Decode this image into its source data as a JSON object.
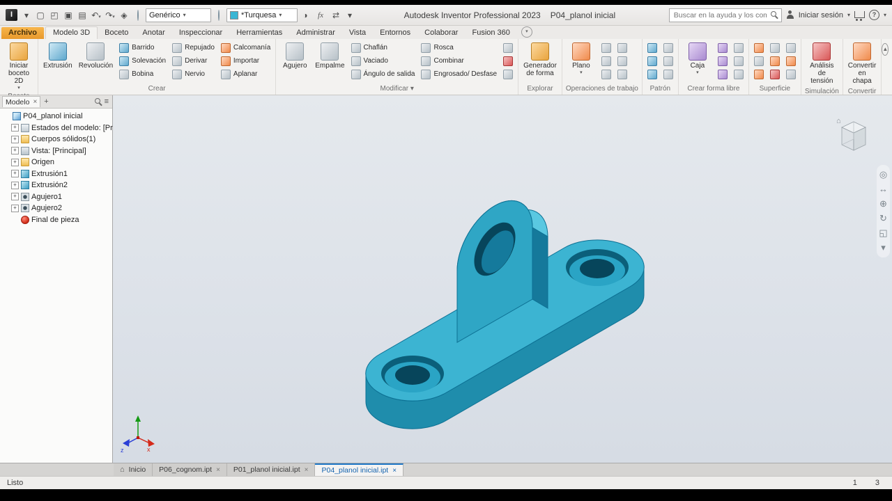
{
  "titlebar": {
    "app_title": "Autodesk Inventor Professional 2023",
    "doc_title": "P04_planol inicial",
    "template_combo": "Genérico",
    "appearance_combo": "*Turquesa",
    "appearance_swatch": "#3ab6d4",
    "search_placeholder": "Buscar en la ayuda y los comanc",
    "sign_in_label": "Iniciar sesión",
    "left_icons": [
      "app-menu-arrow",
      "new-file",
      "open-folder",
      "save",
      "print",
      "undo",
      "redo",
      "iproperties",
      "material-sphere"
    ],
    "post_icons": [
      "adjust-appearance",
      "parameters-fx",
      "exchange-arrows",
      "overflow-arrow"
    ]
  },
  "tabs": [
    {
      "label": "Archivo",
      "accent": true
    },
    {
      "label": "Modelo 3D",
      "active": true
    },
    {
      "label": "Boceto"
    },
    {
      "label": "Anotar"
    },
    {
      "label": "Inspeccionar"
    },
    {
      "label": "Herramientas"
    },
    {
      "label": "Administrar"
    },
    {
      "label": "Vista"
    },
    {
      "label": "Entornos"
    },
    {
      "label": "Colaborar"
    },
    {
      "label": "Fusion 360"
    }
  ],
  "ribbon": {
    "panels": [
      {
        "label": "Boceto",
        "big": [
          {
            "label": "Iniciar boceto 2D",
            "icon": "sketch-2d",
            "arrow": true
          }
        ]
      },
      {
        "label": "Crear",
        "big": [
          {
            "label": "Extrusión",
            "icon": "extrude"
          },
          {
            "label": "Revolución",
            "icon": "revolve"
          }
        ],
        "cols": [
          [
            {
              "label": "Barrido",
              "icon": "sweep"
            },
            {
              "label": "Solevación",
              "icon": "loft"
            },
            {
              "label": "Bobina",
              "icon": "coil"
            }
          ],
          [
            {
              "label": "Repujado",
              "icon": "emboss"
            },
            {
              "label": "Derivar",
              "icon": "derive"
            },
            {
              "label": "Nervio",
              "icon": "rib"
            }
          ],
          [
            {
              "label": "Calcomanía",
              "icon": "decal"
            },
            {
              "label": "Importar",
              "icon": "import"
            },
            {
              "label": "Aplanar",
              "icon": "unwrap"
            }
          ]
        ]
      },
      {
        "label": "Modificar",
        "arrow": true,
        "big": [
          {
            "label": "Agujero",
            "icon": "hole"
          },
          {
            "label": "Empalme",
            "icon": "fillet"
          }
        ],
        "cols": [
          [
            {
              "label": "Chaflán",
              "icon": "chamfer"
            },
            {
              "label": "Vaciado",
              "icon": "shell"
            },
            {
              "label": "Ángulo de salida",
              "icon": "draft"
            }
          ],
          [
            {
              "label": "Rosca",
              "icon": "thread"
            },
            {
              "label": "Combinar",
              "icon": "combine"
            },
            {
              "label": "Engrosado/ Desfase",
              "icon": "thicken"
            }
          ],
          [
            {
              "icon": "split"
            },
            {
              "icon": "delete-face"
            },
            {
              "icon": "move-body"
            }
          ]
        ]
      },
      {
        "label": "Explorar",
        "big": [
          {
            "label": "Generador de forma",
            "icon": "shape-generator"
          }
        ]
      },
      {
        "label": "Operaciones de trabajo",
        "big": [
          {
            "label": "Plano",
            "icon": "work-plane",
            "arrow": true
          }
        ],
        "cols": [
          [
            {
              "icon": "work-axis"
            },
            {
              "icon": "work-point"
            },
            {
              "icon": "ucs"
            }
          ],
          [
            {
              "icon": "axis-from-edge"
            },
            {
              "icon": "grounded-point"
            },
            {
              "icon": "ucs-3points"
            }
          ]
        ]
      },
      {
        "label": "Patrón",
        "cols": [
          [
            {
              "icon": "pattern-rectangular"
            },
            {
              "icon": "pattern-circular"
            },
            {
              "icon": "mirror"
            }
          ],
          [
            {
              "icon": "pattern-sketch"
            },
            {
              "icon": "pattern-feature"
            },
            {
              "icon": "pattern-path"
            }
          ]
        ]
      },
      {
        "label": "Crear forma libre",
        "big": [
          {
            "label": "Caja",
            "icon": "freeform-box",
            "arrow": true
          }
        ],
        "cols": [
          [
            {
              "icon": "freeform-plane"
            },
            {
              "icon": "freeform-cylinder"
            },
            {
              "icon": "freeform-sphere"
            }
          ],
          [
            {
              "icon": "freeform-torus"
            },
            {
              "icon": "freeform-quadball"
            },
            {
              "icon": "freeform-edit"
            }
          ]
        ]
      },
      {
        "label": "Superficie",
        "cols": [
          [
            {
              "icon": "surface-stitch"
            },
            {
              "icon": "surface-patch"
            },
            {
              "icon": "surface-trim"
            }
          ],
          [
            {
              "icon": "surface-extend"
            },
            {
              "icon": "surface-sculpt"
            },
            {
              "icon": "surface-repair"
            }
          ],
          [
            {
              "icon": "surface-offset"
            },
            {
              "icon": "surface-delete"
            },
            {
              "icon": "surface-fit"
            }
          ]
        ]
      },
      {
        "label": "Simulación",
        "big": [
          {
            "label": "Análisis de tensión",
            "icon": "stress-analysis"
          }
        ]
      },
      {
        "label": "Convertir",
        "big": [
          {
            "label": "Convertir en chapa",
            "icon": "sheet-metal"
          }
        ]
      }
    ]
  },
  "browser": {
    "tab": "Modelo",
    "items": [
      {
        "label": "P04_planol inicial",
        "icon": "part-root",
        "level": 0,
        "expander": "none"
      },
      {
        "label": "Estados del modelo: [Principal]",
        "icon": "model-states",
        "level": 1,
        "expander": "plus"
      },
      {
        "label": "Cuerpos sólidos(1)",
        "icon": "solid-bodies",
        "level": 1,
        "expander": "plus"
      },
      {
        "label": "Vista: [Principal]",
        "icon": "view-rep",
        "level": 1,
        "expander": "plus"
      },
      {
        "label": "Origen",
        "icon": "origin-folder",
        "level": 1,
        "expander": "plus"
      },
      {
        "label": "Extrusión1",
        "icon": "extrusion-feat",
        "level": 1,
        "expander": "plus"
      },
      {
        "label": "Extrusión2",
        "icon": "extrusion-feat",
        "level": 1,
        "expander": "plus"
      },
      {
        "label": "Agujero1",
        "icon": "hole-feat",
        "level": 1,
        "expander": "plus"
      },
      {
        "label": "Agujero2",
        "icon": "hole-feat",
        "level": 1,
        "expander": "plus"
      },
      {
        "label": "Final de pieza",
        "icon": "end-of-part",
        "level": 1,
        "expander": "none"
      }
    ]
  },
  "viewport": {
    "palette": {
      "top": "#3cb4d2",
      "side": "#1f8dac",
      "lug_front": "#2fa6c5",
      "lug_band": "#5ac8e1",
      "lug_side": "#15799b",
      "hole_wall": "#0b5f7a",
      "hole_floor": "#2aa4c5",
      "hole_inner": "#07455b",
      "lug_hole_lit": "#157a9c",
      "edge": "#0c7093"
    },
    "triad_labels": {
      "x": "x",
      "z": "z"
    },
    "nav_icons": [
      "navigation-wheel",
      "pan",
      "zoom",
      "orbit",
      "look-at",
      "collapse"
    ]
  },
  "doc_tabs": [
    {
      "label": "Inicio",
      "icon": "home",
      "closable": false
    },
    {
      "label": "P06_cognom.ipt",
      "closable": true
    },
    {
      "label": "P01_planol inicial.ipt",
      "closable": true
    },
    {
      "label": "P04_planol inicial.ipt",
      "closable": true,
      "active": true
    }
  ],
  "statusbar": {
    "left": "Listo",
    "right": [
      "1",
      "3"
    ]
  }
}
